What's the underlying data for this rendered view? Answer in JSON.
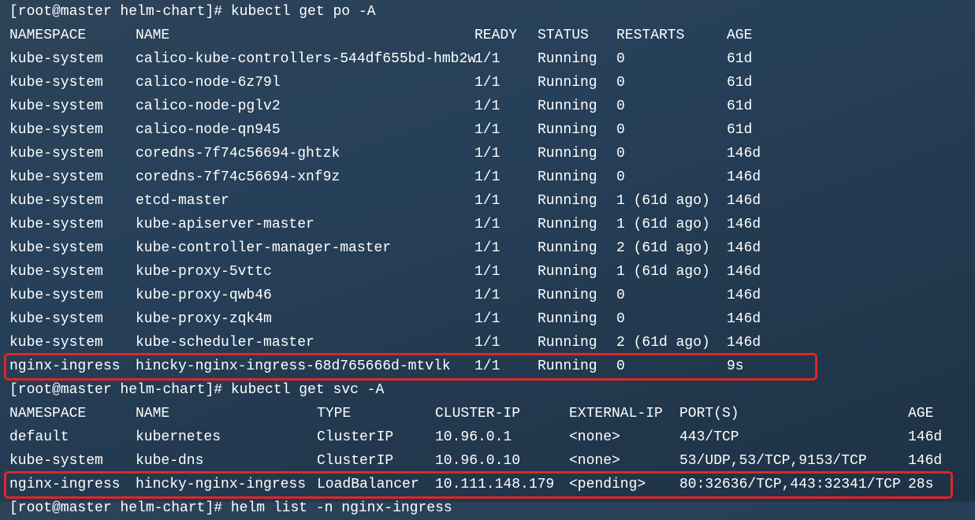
{
  "commands": [
    "[root@master helm-chart]# kubectl get po -A",
    "[root@master helm-chart]# kubectl get svc -A",
    "[root@master helm-chart]# helm list -n nginx-ingress"
  ],
  "pods": {
    "headers": [
      "NAMESPACE",
      "NAME",
      "READY",
      "STATUS",
      "RESTARTS",
      "AGE"
    ],
    "rows": [
      [
        "kube-system",
        "calico-kube-controllers-544df655bd-hmb2w",
        "1/1",
        "Running",
        "0",
        "61d"
      ],
      [
        "kube-system",
        "calico-node-6z79l",
        "1/1",
        "Running",
        "0",
        "61d"
      ],
      [
        "kube-system",
        "calico-node-pglv2",
        "1/1",
        "Running",
        "0",
        "61d"
      ],
      [
        "kube-system",
        "calico-node-qn945",
        "1/1",
        "Running",
        "0",
        "61d"
      ],
      [
        "kube-system",
        "coredns-7f74c56694-ghtzk",
        "1/1",
        "Running",
        "0",
        "146d"
      ],
      [
        "kube-system",
        "coredns-7f74c56694-xnf9z",
        "1/1",
        "Running",
        "0",
        "146d"
      ],
      [
        "kube-system",
        "etcd-master",
        "1/1",
        "Running",
        "1 (61d ago)",
        "146d"
      ],
      [
        "kube-system",
        "kube-apiserver-master",
        "1/1",
        "Running",
        "1 (61d ago)",
        "146d"
      ],
      [
        "kube-system",
        "kube-controller-manager-master",
        "1/1",
        "Running",
        "2 (61d ago)",
        "146d"
      ],
      [
        "kube-system",
        "kube-proxy-5vttc",
        "1/1",
        "Running",
        "1 (61d ago)",
        "146d"
      ],
      [
        "kube-system",
        "kube-proxy-qwb46",
        "1/1",
        "Running",
        "0",
        "146d"
      ],
      [
        "kube-system",
        "kube-proxy-zqk4m",
        "1/1",
        "Running",
        "0",
        "146d"
      ],
      [
        "kube-system",
        "kube-scheduler-master",
        "1/1",
        "Running",
        "2 (61d ago)",
        "146d"
      ],
      [
        "nginx-ingress",
        "hincky-nginx-ingress-68d765666d-mtvlk",
        "1/1",
        "Running",
        "0",
        "9s"
      ]
    ]
  },
  "services": {
    "headers": [
      "NAMESPACE",
      "NAME",
      "TYPE",
      "CLUSTER-IP",
      "EXTERNAL-IP",
      "PORT(S)",
      "AGE"
    ],
    "rows": [
      [
        "default",
        "kubernetes",
        "ClusterIP",
        "10.96.0.1",
        "<none>",
        "443/TCP",
        "146d"
      ],
      [
        "kube-system",
        "kube-dns",
        "ClusterIP",
        "10.96.0.10",
        "<none>",
        "53/UDP,53/TCP,9153/TCP",
        "146d"
      ],
      [
        "nginx-ingress",
        "hincky-nginx-ingress",
        "LoadBalancer",
        "10.111.148.179",
        "<pending>",
        "80:32636/TCP,443:32341/TCP",
        "28s"
      ]
    ]
  },
  "colors": {
    "text": "#ffffff",
    "highlight": "#e02626",
    "background": "#263d54"
  }
}
